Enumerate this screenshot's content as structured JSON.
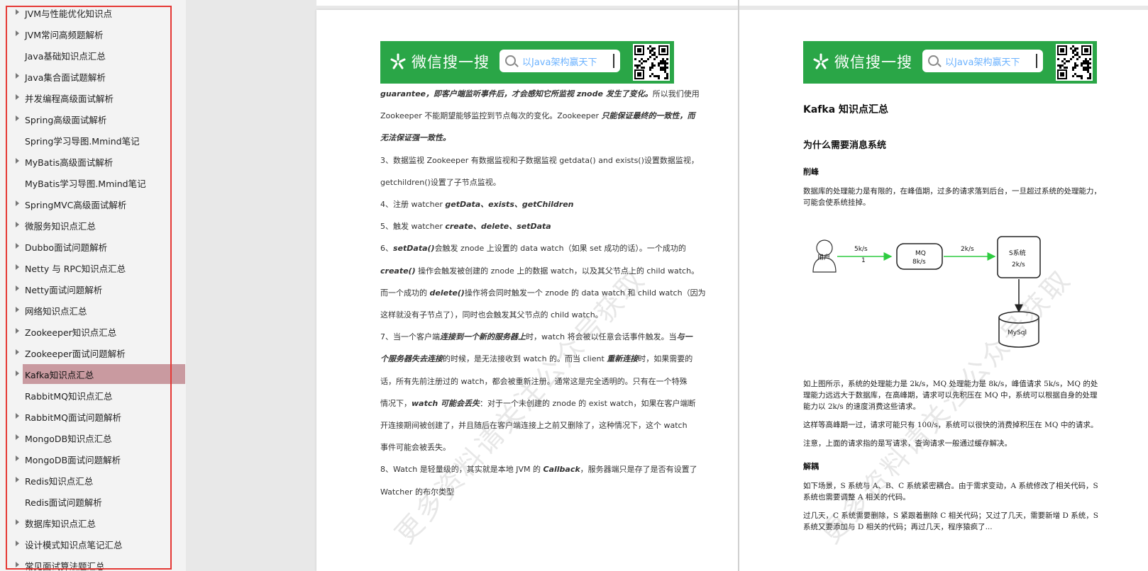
{
  "sidebar": {
    "items": [
      {
        "label": "JVM与性能优化知识点",
        "arrow": true
      },
      {
        "label": "JVM常问高频题解析",
        "arrow": true
      },
      {
        "label": "Java基础知识点汇总",
        "arrow": false
      },
      {
        "label": "Java集合面试题解析",
        "arrow": true
      },
      {
        "label": "并发编程高级面试解析",
        "arrow": true
      },
      {
        "label": "Spring高级面试解析",
        "arrow": true
      },
      {
        "label": "Spring学习导图.Mmind笔记",
        "arrow": false
      },
      {
        "label": "MyBatis高级面试解析",
        "arrow": true
      },
      {
        "label": "MyBatis学习导图.Mmind笔记",
        "arrow": false
      },
      {
        "label": "SpringMVC高级面试解析",
        "arrow": true
      },
      {
        "label": "微服务知识点汇总",
        "arrow": true
      },
      {
        "label": "Dubbo面试问题解析",
        "arrow": true
      },
      {
        "label": " Netty 与 RPC知识点汇总",
        "arrow": true
      },
      {
        "label": "Netty面试问题解析",
        "arrow": true
      },
      {
        "label": "网络知识点汇总",
        "arrow": true
      },
      {
        "label": "Zookeeper知识点汇总",
        "arrow": true
      },
      {
        "label": "Zookeeper面试问题解析",
        "arrow": true
      },
      {
        "label": "Kafka知识点汇总",
        "arrow": true,
        "selected": true
      },
      {
        "label": "RabbitMQ知识点汇总",
        "arrow": false
      },
      {
        "label": "RabbitMQ面试问题解析",
        "arrow": true
      },
      {
        "label": "MongoDB知识点汇总",
        "arrow": true
      },
      {
        "label": "MongoDB面试问题解析",
        "arrow": true
      },
      {
        "label": "Redis知识点汇总",
        "arrow": true
      },
      {
        "label": "Redis面试问题解析",
        "arrow": false
      },
      {
        "label": "数据库知识点汇总",
        "arrow": true
      },
      {
        "label": "设计模式知识点笔记汇总",
        "arrow": true
      },
      {
        "label": "常见面试算法题汇总",
        "arrow": true
      }
    ]
  },
  "banner": {
    "title": "微信搜一搜",
    "search_text": "以Java架构赢天下"
  },
  "left_page": {
    "lines": [
      "<b>guarantee，即客户端监听事件后，才会感知它所监视 znode 发生了变化。</b>所以我们使用",
      "Zookeeper 不能期望能够监控到节点每次的变化。Zookeeper <b>只能保证最终的一致性，而</b>",
      "<b>无法保证强一致性。</b>",
      "3、数据监视 Zookeeper 有数据监视和子数据监视 getdata() and exists()设置数据监视，",
      "getchildren()设置了子节点监视。",
      "4、注册 watcher <b>getData、exists、getChildren</b>",
      "5、触发 watcher <b>create、delete、setData</b>",
      "6、<b>setData()</b>会触发 znode 上设置的 data watch（如果 set 成功的话）。一个成功的",
      "<b>create()</b> 操作会触发被创建的 znode 上的数据 watch，以及其父节点上的 child watch。",
      "而一个成功的 <b>delete()</b>操作将会同时触发一个 znode 的 data watch 和 child watch（因为",
      "这样就没有子节点了），同时也会触发其父节点的 child watch。",
      "7、当一个客户端<b>连接到一个新的服务器上</b>时，watch 将会被以任意会话事件触发。当<b>与一</b>",
      "<b>个服务器失去连接</b>的时候，是无法接收到 watch 的。而当 client <b>重新连接</b>时，如果需要的",
      "话，所有先前注册过的 watch，都会被重新注册。通常这是完全透明的。只有在一个特殊",
      "情况下，<b>watch 可能会丢失</b>：对于一个未创建的 znode 的 exist watch，如果在客户端断",
      "开连接期间被创建了，并且随后在客户端连接上之前又删除了，这种情况下，这个 watch",
      "事件可能会被丢失。",
      "8、Watch 是轻量级的，其实就是本地 JVM 的 <b>Callback</b>，服务器端只是存了是否有设置了",
      "Watcher 的布尔类型"
    ]
  },
  "right_page": {
    "title": "Kafka 知识点汇总",
    "section": "为什么需要消息系统",
    "sub1": "削峰",
    "p1": "数据库的处理能力是有限的，在峰值期，过多的请求落到后台，一旦超过系统的处理能力，可能会使系统挂掉。",
    "diagram": {
      "user": "用户",
      "rate1": "5k/s",
      "rate1b": "1",
      "mq": "MQ",
      "mq_rate": "8k/s",
      "rate2": "2k/s",
      "s": "S系统",
      "s_rate": "2k/s",
      "db": "MySql"
    },
    "p2": "如上图所示，系统的处理能力是 2k/s，MQ 处理能力是 8k/s，峰值请求 5k/s，MQ 的处理能力远远大于数据库，在高峰期，请求可以先积压在 MQ 中，系统可以根据自身的处理能力以 2k/s 的速度消费这些请求。",
    "p3": "这样等高峰期一过，请求可能只有 100/s，系统可以很快的消费掉积压在 MQ 中的请求。",
    "p4": "注意，上面的请求指的是写请求，查询请求一般通过缓存解决。",
    "sub2": "解耦",
    "p5": "如下场景，S 系统与 A、B、C 系统紧密耦合。由于需求变动，A 系统修改了相关代码，S 系统也需要调整 A 相关的代码。",
    "p6": "过几天，C 系统需要删除，S 紧跟着删除 C 相关代码；又过了几天，需要新增 D 系统，S 系统又要添加与 D 相关的代码；再过几天，程序猿疯了..."
  },
  "watermark": "更多资料请关注公众号获取"
}
